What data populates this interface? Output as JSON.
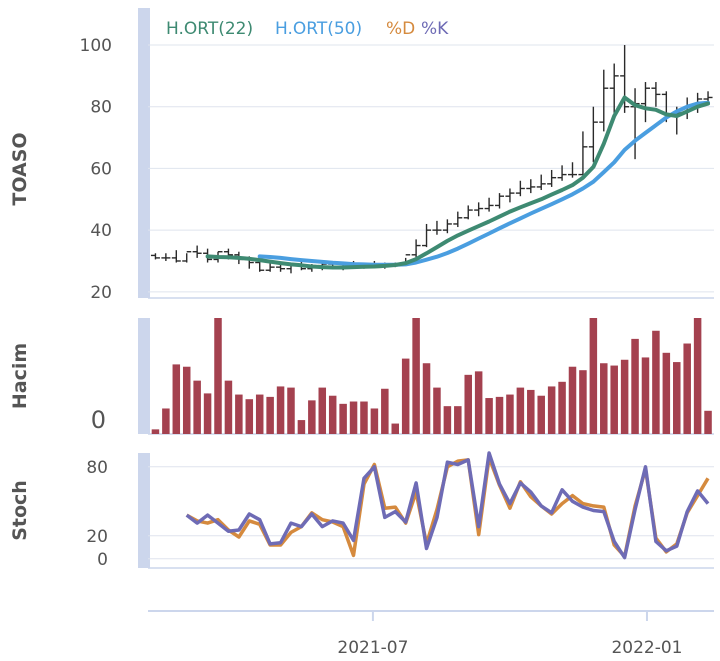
{
  "colors": {
    "ma22": "#3e8a72",
    "ma50": "#4a9ee0",
    "stoch_d": "#d58a3e",
    "stoch_k": "#6e6bb5",
    "volume": "#a4414f",
    "price": "#2a2a2a",
    "grid": "#dfe4ee",
    "axis_band": "#ccd6ec"
  },
  "legend": {
    "ma22": "H.ORT(22)",
    "ma50": "H.ORT(50)",
    "stoch_d": "%D",
    "stoch_k": "%K"
  },
  "x_axis": {
    "ticks": [
      {
        "date": "2021-07-01",
        "label": "2021-07"
      },
      {
        "date": "2022-01-01",
        "label": "2022-01"
      }
    ]
  },
  "chart_data": [
    {
      "type": "ohlc",
      "ylabel": "TOASO",
      "ylim": [
        18,
        112
      ],
      "yticks": [
        20,
        40,
        60,
        80,
        100
      ],
      "dates": [
        "2021-02-05",
        "2021-02-12",
        "2021-02-19",
        "2021-02-26",
        "2021-03-05",
        "2021-03-12",
        "2021-03-19",
        "2021-03-26",
        "2021-04-02",
        "2021-04-09",
        "2021-04-16",
        "2021-04-23",
        "2021-04-30",
        "2021-05-07",
        "2021-05-14",
        "2021-05-21",
        "2021-05-28",
        "2021-06-04",
        "2021-06-11",
        "2021-06-18",
        "2021-06-25",
        "2021-07-02",
        "2021-07-09",
        "2021-07-16",
        "2021-07-23",
        "2021-07-30",
        "2021-08-06",
        "2021-08-13",
        "2021-08-20",
        "2021-08-27",
        "2021-09-03",
        "2021-09-10",
        "2021-09-17",
        "2021-09-24",
        "2021-10-01",
        "2021-10-08",
        "2021-10-15",
        "2021-10-22",
        "2021-10-29",
        "2021-11-05",
        "2021-11-12",
        "2021-11-19",
        "2021-11-26",
        "2021-12-03",
        "2021-12-10",
        "2021-12-17",
        "2021-12-24",
        "2021-12-31",
        "2022-01-07",
        "2022-01-14",
        "2022-01-21",
        "2022-01-28",
        "2022-02-04",
        "2022-02-11"
      ],
      "series": [
        {
          "name": "Price",
          "open": [
            31.8,
            31.0,
            31.0,
            30.0,
            33.0,
            32.5,
            30.5,
            33.0,
            32.0,
            30.5,
            29.5,
            27.0,
            28.0,
            27.5,
            28.5,
            27.5,
            28.5,
            29.0,
            27.5,
            28.0,
            28.0,
            29.0,
            28.5,
            28.5,
            29.0,
            32.0,
            35.0,
            40.0,
            40.0,
            42.0,
            44.0,
            46.5,
            47.0,
            48.0,
            51.0,
            52.0,
            53.5,
            54.0,
            55.0,
            57.0,
            58.0,
            58.0,
            67.0,
            75.0,
            86.0,
            90.0,
            80.0,
            81.0,
            86.0,
            84.0,
            77.0,
            78.0,
            80.0,
            82.5
          ],
          "high": [
            32.5,
            32.5,
            33.5,
            32.5,
            35.0,
            34.0,
            33.0,
            34.0,
            33.0,
            31.5,
            30.0,
            29.5,
            29.5,
            29.0,
            30.0,
            29.0,
            30.0,
            30.0,
            29.0,
            30.0,
            29.5,
            30.0,
            29.5,
            29.5,
            31.0,
            37.0,
            42.0,
            43.0,
            43.5,
            46.0,
            48.0,
            49.0,
            50.5,
            52.0,
            53.5,
            56.0,
            56.5,
            58.0,
            59.5,
            61.0,
            62.0,
            72.0,
            80.0,
            92.0,
            94.0,
            100.0,
            86.0,
            88.0,
            88.0,
            85.0,
            80.0,
            83.0,
            84.5,
            85.0
          ],
          "low": [
            30.5,
            30.0,
            29.5,
            29.5,
            31.0,
            29.5,
            29.5,
            30.5,
            29.0,
            27.5,
            26.5,
            26.5,
            26.5,
            26.0,
            27.0,
            26.5,
            27.0,
            27.5,
            27.0,
            27.5,
            27.5,
            28.0,
            27.5,
            28.0,
            28.5,
            30.0,
            34.5,
            38.5,
            39.0,
            41.0,
            43.5,
            44.5,
            46.0,
            47.0,
            49.0,
            51.0,
            52.0,
            53.0,
            54.0,
            56.0,
            57.0,
            58.0,
            62.0,
            72.0,
            78.0,
            78.0,
            63.0,
            75.0,
            80.0,
            75.0,
            71.0,
            76.0,
            78.0,
            80.5
          ],
          "close": [
            31.0,
            31.0,
            30.0,
            33.0,
            32.5,
            30.5,
            33.0,
            32.0,
            30.5,
            29.5,
            27.0,
            28.0,
            27.5,
            28.5,
            27.5,
            28.5,
            29.0,
            27.5,
            28.0,
            28.0,
            29.0,
            28.5,
            28.5,
            29.0,
            32.0,
            35.0,
            40.0,
            40.0,
            42.0,
            44.0,
            46.5,
            47.0,
            48.0,
            51.0,
            52.0,
            53.5,
            54.0,
            55.0,
            57.0,
            58.0,
            58.0,
            67.0,
            75.0,
            86.0,
            90.0,
            80.0,
            81.0,
            86.0,
            84.0,
            77.0,
            78.0,
            80.0,
            82.5,
            83.0
          ]
        },
        {
          "name": "H.ORT(22)",
          "values": [
            null,
            null,
            null,
            null,
            null,
            31.5,
            31.3,
            31.2,
            31.0,
            30.7,
            30.3,
            29.8,
            29.3,
            28.9,
            28.6,
            28.2,
            28.0,
            27.9,
            27.9,
            28.0,
            28.1,
            28.2,
            28.4,
            28.7,
            29.3,
            30.6,
            32.5,
            34.5,
            36.5,
            38.3,
            39.8,
            41.3,
            42.8,
            44.4,
            46.0,
            47.4,
            48.7,
            50.0,
            51.5,
            53.0,
            54.6,
            57.0,
            60.5,
            68.0,
            77.0,
            83.0,
            80.5,
            79.5,
            79.0,
            77.5,
            77.0,
            78.5,
            80.0,
            81.0
          ]
        },
        {
          "name": "H.ORT(50)",
          "values": [
            null,
            null,
            null,
            null,
            null,
            null,
            null,
            null,
            null,
            null,
            31.5,
            31.3,
            31.0,
            30.6,
            30.3,
            30.0,
            29.7,
            29.4,
            29.2,
            29.0,
            28.9,
            28.8,
            28.8,
            28.8,
            28.9,
            29.5,
            30.4,
            31.4,
            32.6,
            34.0,
            35.6,
            37.3,
            38.9,
            40.6,
            42.2,
            43.8,
            45.4,
            46.9,
            48.4,
            50.0,
            51.6,
            53.5,
            55.7,
            58.8,
            62.0,
            66.0,
            69.0,
            71.5,
            74.0,
            76.5,
            78.5,
            80.0,
            81.0,
            81.3
          ]
        }
      ]
    },
    {
      "type": "bar",
      "ylabel": "Hacim",
      "yticks": [
        0
      ],
      "ylim": [
        0,
        100
      ],
      "values": [
        4,
        22,
        60,
        58,
        46,
        35,
        100,
        46,
        34,
        30,
        34,
        32,
        41,
        40,
        12,
        29,
        40,
        33,
        26,
        28,
        28,
        22,
        39,
        9,
        65,
        100,
        61,
        40,
        24,
        24,
        51,
        54,
        31,
        32,
        34,
        40,
        38,
        33,
        41,
        45,
        58,
        55,
        100,
        61,
        59,
        64,
        82,
        66,
        89,
        70,
        62,
        78,
        100,
        20
      ]
    },
    {
      "type": "line",
      "ylabel": "Stoch",
      "yticks": [
        0,
        20,
        80
      ],
      "ylim": [
        -8,
        92
      ],
      "series": [
        {
          "name": "%D",
          "values": [
            null,
            null,
            null,
            38,
            33,
            31,
            34,
            25,
            19,
            33,
            30,
            12,
            12,
            23,
            28,
            40,
            34,
            32,
            28,
            3,
            65,
            82,
            44,
            45,
            31,
            58,
            13,
            43,
            80,
            85,
            86,
            21,
            88,
            64,
            44,
            67,
            54,
            46,
            39,
            48,
            55,
            48,
            46,
            45,
            12,
            2,
            46,
            78,
            18,
            6,
            13,
            40,
            55,
            70
          ]
        },
        {
          "name": "%K",
          "values": [
            null,
            null,
            null,
            38,
            31,
            38,
            31,
            24,
            25,
            39,
            34,
            13,
            14,
            31,
            28,
            39,
            28,
            33,
            31,
            16,
            70,
            80,
            36,
            41,
            32,
            66,
            9,
            36,
            84,
            82,
            86,
            28,
            92,
            65,
            48,
            66,
            58,
            46,
            40,
            60,
            50,
            45,
            42,
            41,
            15,
            1,
            43,
            80,
            15,
            7,
            11,
            41,
            59,
            48
          ]
        }
      ]
    }
  ]
}
